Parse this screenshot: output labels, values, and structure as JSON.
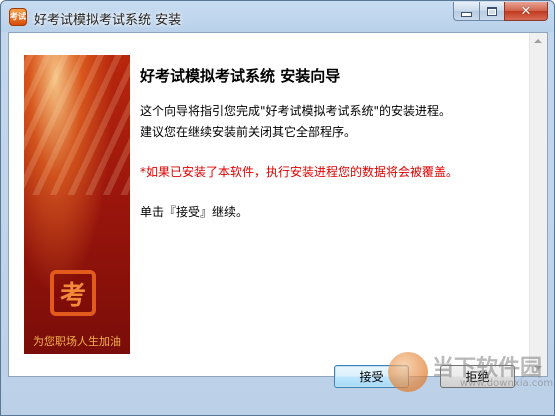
{
  "window": {
    "title": "好考试模拟考试系统 安装",
    "icon": "installer-app-icon"
  },
  "banner": {
    "logo_char": "考",
    "slogan": "为您职场人生加油"
  },
  "content": {
    "heading": "好考试模拟考试系统  安装向导",
    "line1": "这个向导将指引您完成\"好考试模拟考试系统\"的安装进程。",
    "line2": "建议您在继续安装前关闭其它全部程序。",
    "warning": "*如果已安装了本软件，执行安装进程您的数据将会被覆盖。",
    "instruction": "单击『接受』继续。"
  },
  "buttons": {
    "accept": "接受",
    "decline": "拒绝"
  },
  "watermark": {
    "text": "当下软件园",
    "url": "www.downxia.com"
  },
  "colors": {
    "banner_red": "#9c160c",
    "warning_red": "#e20000",
    "slogan_orange": "#f3b24b"
  }
}
